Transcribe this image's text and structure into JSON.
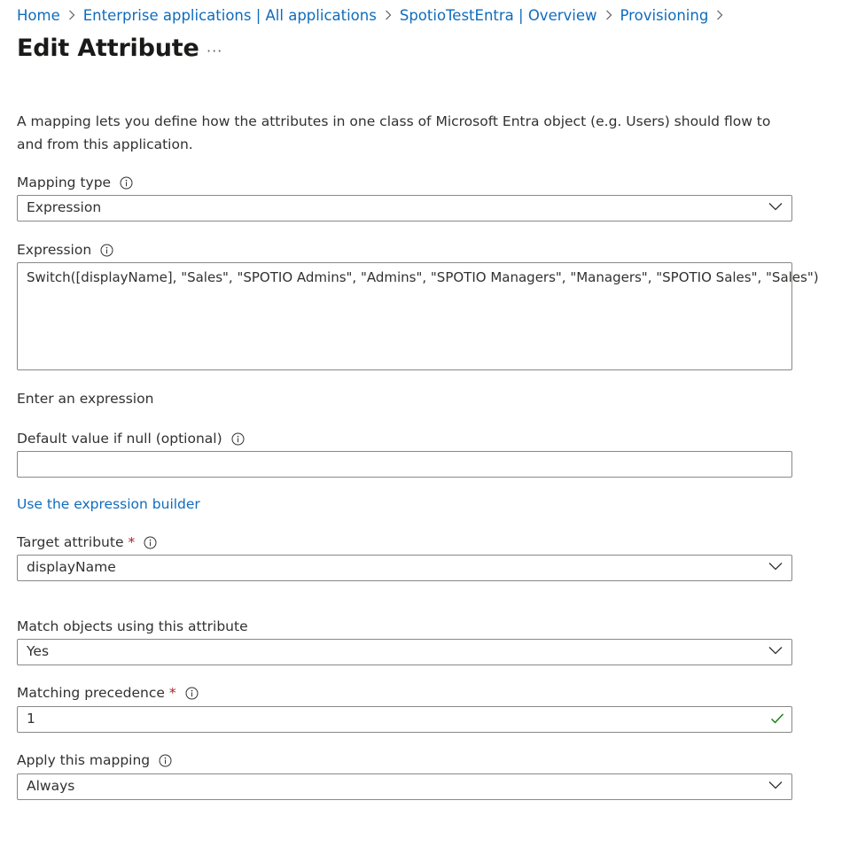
{
  "breadcrumb": {
    "items": [
      {
        "label": "Home"
      },
      {
        "label": "Enterprise applications | All applications"
      },
      {
        "label": "SpotioTestEntra | Overview"
      },
      {
        "label": "Provisioning"
      }
    ]
  },
  "header": {
    "title": "Edit Attribute",
    "more_label": "···"
  },
  "description": "A mapping lets you define how the attributes in one class of Microsoft Entra object (e.g. Users) should flow to and from this application.",
  "mapping_type": {
    "label": "Mapping type",
    "value": "Expression"
  },
  "expression": {
    "label": "Expression",
    "value": "Switch([displayName], \"Sales\", \"SPOTIO Admins\", \"Admins\", \"SPOTIO Managers\", \"Managers\", \"SPOTIO Sales\", \"Sales\")",
    "helper": "Enter an expression"
  },
  "default_value": {
    "label": "Default value if null (optional)",
    "value": ""
  },
  "expression_builder_link": "Use the expression builder",
  "target_attribute": {
    "label": "Target attribute",
    "required_marker": "*",
    "value": "displayName"
  },
  "match_objects": {
    "label": "Match objects using this attribute",
    "value": "Yes"
  },
  "matching_precedence": {
    "label": "Matching precedence",
    "required_marker": "*",
    "value": "1"
  },
  "apply_mapping": {
    "label": "Apply this mapping",
    "value": "Always"
  },
  "icons": {
    "info": "info-icon",
    "chevron": "chevron-down-icon",
    "separator": "chevron-right-icon",
    "valid": "checkmark-icon"
  },
  "colors": {
    "link": "#0f6cbd",
    "required": "#a4262c",
    "valid": "#107c10",
    "border": "#8a8886"
  }
}
